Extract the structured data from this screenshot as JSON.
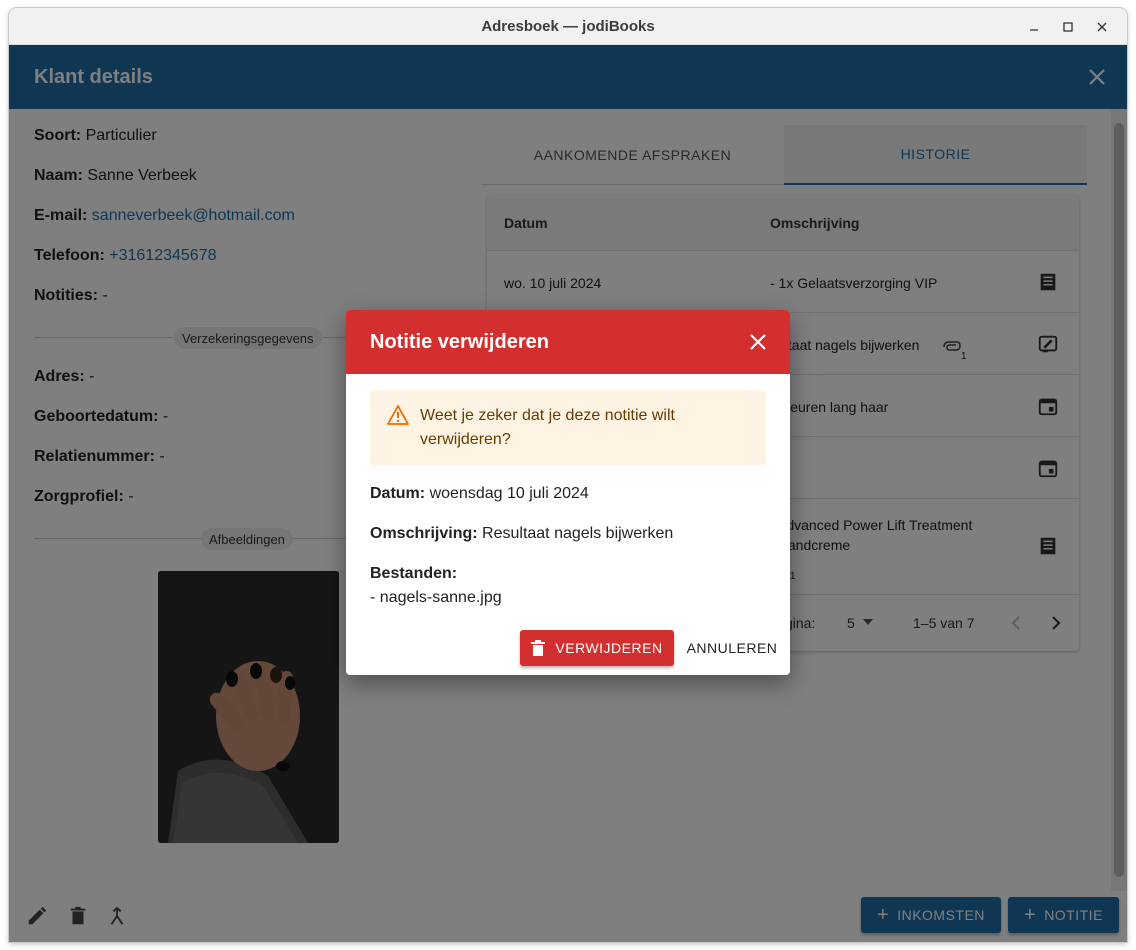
{
  "window": {
    "title": "Adresboek — jodiBooks",
    "controls": [
      "minimize-icon",
      "maximize-icon",
      "close-icon"
    ]
  },
  "appbar": {
    "title": "Klant details"
  },
  "customer": {
    "soort_label": "Soort:",
    "soort": "Particulier",
    "naam_label": "Naam:",
    "naam": "Sanne Verbeek",
    "email_label": "E-mail:",
    "email": "sanneverbeek@hotmail.com",
    "telefoon_label": "Telefoon:",
    "telefoon": "+31612345678",
    "notities_label": "Notities:",
    "notities": "-",
    "verzekering_chip": "Verzekeringsgegevens",
    "adres_label": "Adres:",
    "adres": "-",
    "geboortedatum_label": "Geboortedatum:",
    "geboortedatum": "-",
    "relatienummer_label": "Relatienummer:",
    "relatienummer": "-",
    "zorgprofiel_label": "Zorgprofiel:",
    "zorgprofiel": "-",
    "afbeeldingen_chip": "Afbeeldingen"
  },
  "tabs": [
    {
      "label": "AANKOMENDE AFSPRAKEN",
      "active": false
    },
    {
      "label": "HISTORIE",
      "active": true
    }
  ],
  "table": {
    "headers": [
      "Datum",
      "Omschrijving"
    ],
    "rows": [
      {
        "datum": "wo. 10 juli 2024",
        "omschrijving": "- 1x Gelaatsverzorging VIP",
        "icon": "receipt-icon"
      },
      {
        "datum": "",
        "omschrijving": "sultaat nagels bijwerken",
        "attachments": "1",
        "icon": "note-edit-icon"
      },
      {
        "datum": "",
        "omschrijving": ": Kleuren lang haar",
        "icon": "calendar-icon"
      },
      {
        "datum": "",
        "omschrijving": "",
        "icon": "calendar-icon"
      },
      {
        "datum": "",
        "omschrijving": ": Advanced Power Lift Treatment",
        "omschrijving2": ": Handcreme",
        "attachments": "1",
        "icon": "receipt-icon"
      }
    ],
    "pager": {
      "rows_label": "gina:",
      "rows_per_page": "5",
      "range": "1–5 van 7"
    }
  },
  "bottom": {
    "inkomsten_label": "INKOMSTEN",
    "notitie_label": "NOTITIE"
  },
  "dialog": {
    "title": "Notitie verwijderen",
    "warning": "Weet je zeker dat je deze notitie wilt verwijderen?",
    "datum_label": "Datum:",
    "datum": "woensdag 10 juli 2024",
    "omschrijving_label": "Omschrijving:",
    "omschrijving": "Resultaat nagels bijwerken",
    "bestanden_label": "Bestanden:",
    "bestand": "- nagels-sanne.jpg",
    "delete_label": "VERWIJDEREN",
    "cancel_label": "ANNULEREN"
  },
  "colors": {
    "primary": "#1f6fa8",
    "danger": "#d32f2f",
    "warning_bg": "#fff3e4",
    "warning_text": "#663c00"
  }
}
